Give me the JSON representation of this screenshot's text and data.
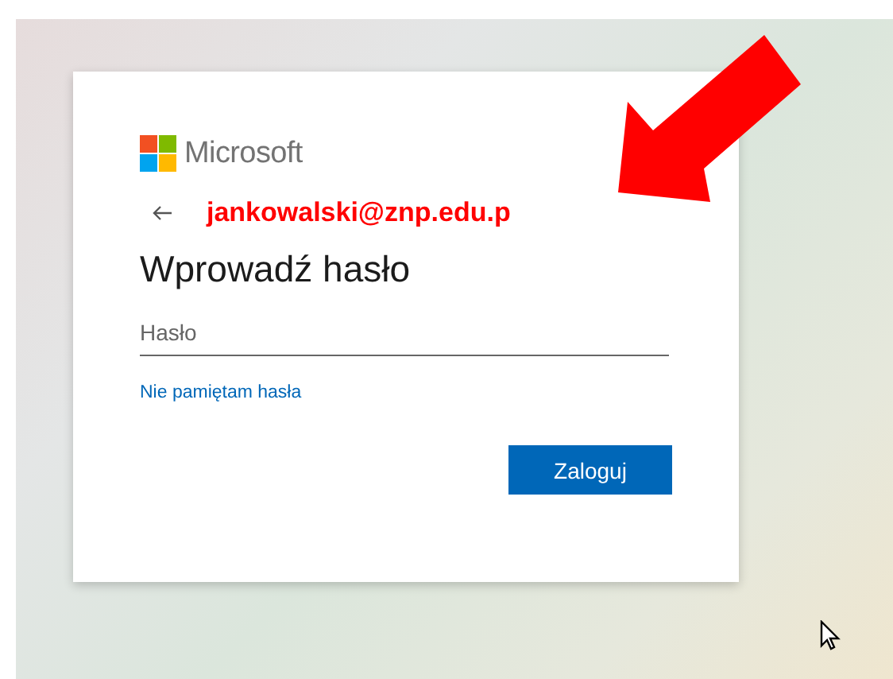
{
  "card": {
    "brand": "Microsoft",
    "account": "jankowalski@znp.edu.p",
    "title": "Wprowadź hasło",
    "password": {
      "placeholder": "Hasło"
    },
    "forgot_link": "Nie pamiętam hasła",
    "submit": "Zaloguj"
  }
}
